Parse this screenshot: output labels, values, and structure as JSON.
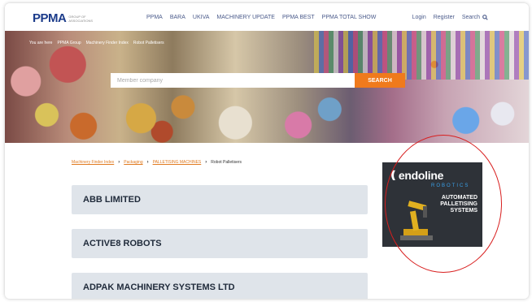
{
  "header": {
    "logo": "PPMA",
    "logo_sub": "GROUP OF ASSOCIATIONS",
    "nav": [
      "PPMA",
      "BARA",
      "UKIVA",
      "MACHINERY UPDATE",
      "PPMA BEST",
      "PPMA TOTAL SHOW"
    ],
    "login": "Login",
    "register": "Register",
    "search": "Search"
  },
  "hero": {
    "breadcrumb": [
      "You are here",
      "PPMA Group",
      "Machinery Finder Index",
      "Robot Palletisers"
    ],
    "search_placeholder": "Member company",
    "search_button": "SEARCH"
  },
  "breadcrumb": {
    "items": [
      "Machinery Finder Index",
      "Packaging",
      "PALLETISING MACHINES"
    ],
    "current": "Robot Palletisers"
  },
  "companies": [
    "ABB LIMITED",
    "ACTIVE8 ROBOTS",
    "ADPAK MACHINERY SYSTEMS LTD"
  ],
  "ad": {
    "brand": "endoline",
    "brand_sub": "ROBOTICS",
    "headline_lines": [
      "AUTOMATED",
      "PALLETISING",
      "SYSTEMS"
    ]
  },
  "colors": {
    "brand_blue": "#1b3b8a",
    "accent_orange": "#f07a1c",
    "highlight_red": "#d81e1e",
    "card_grey": "#dfe4ea"
  }
}
